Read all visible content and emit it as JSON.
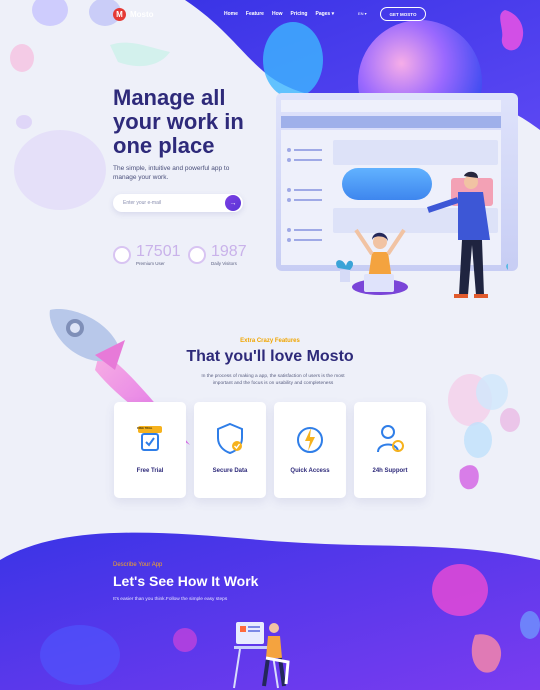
{
  "brand": {
    "name": "Mosto"
  },
  "nav": {
    "items": [
      "Home",
      "Feature",
      "How",
      "Pricing",
      "Pages"
    ],
    "language": "EN",
    "cta": "GET MOSTO"
  },
  "hero": {
    "title_lines": [
      "Manage all",
      "your work in",
      "one place"
    ],
    "subtitle_lines": [
      "The simple, intuitive and powerful app to",
      "manage your work."
    ],
    "email_placeholder": "Enter your e-mail",
    "submit_icon": "arrow-right-icon",
    "stats": [
      {
        "value": "17501",
        "label": "Premium User"
      },
      {
        "value": "1987",
        "label": "Daily Visitors"
      }
    ]
  },
  "features": {
    "kicker": "Extra Crazy Features",
    "title": "That you'll love Mosto",
    "description_lines": [
      "In the process of making a app, the satisfaction of users is the most",
      "important and the focus is on usability and completeness"
    ],
    "cards": [
      {
        "label": "Free Trial",
        "icon": "free-trial-icon",
        "tag": "FREE TRIAL"
      },
      {
        "label": "Secure Data",
        "icon": "shield-check-icon"
      },
      {
        "label": "Quick Access",
        "icon": "lightning-icon"
      },
      {
        "label": "24h Support",
        "icon": "support-agent-icon"
      }
    ]
  },
  "how": {
    "kicker": "Describe Your App",
    "title": "Let's See How It Work",
    "subtitle": "It's easier than you think.Follow the simple easy steps"
  },
  "colors": {
    "primary": "#2e2a7a",
    "accent_blue": "#3a40f0",
    "accent_orange": "#f0a500",
    "brand_red": "#e53935"
  }
}
